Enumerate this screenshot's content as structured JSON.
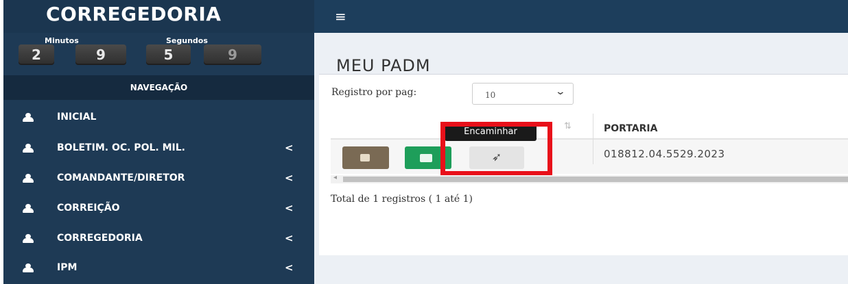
{
  "sidebar": {
    "brand": "CORREGEDORIA",
    "timer": {
      "minutes_label": "Minutos",
      "seconds_label": "Segundos",
      "digits": [
        "2",
        "9",
        "5",
        "9"
      ]
    },
    "nav_header": "NAVEGAÇÃO",
    "items": [
      {
        "label": "INICIAL",
        "icon": "user-icon",
        "chevron": ""
      },
      {
        "label": "BOLETIM. OC. POL. MIL.",
        "icon": "user-icon",
        "chevron": "<"
      },
      {
        "label": "COMANDANTE/DIRETOR",
        "icon": "user-icon",
        "chevron": "<"
      },
      {
        "label": "CORREIÇÃO",
        "icon": "user-icon",
        "chevron": "<"
      },
      {
        "label": "CORREGEDORIA",
        "icon": "user-icon",
        "chevron": "<"
      },
      {
        "label": "IPM",
        "icon": "user-icon",
        "chevron": "<"
      }
    ]
  },
  "header": {
    "menu_glyph": "≡"
  },
  "main": {
    "title": "MEU PADM",
    "per_page_label": "Registro por pag:",
    "per_page_value": "10",
    "sort_glyph": "⇅",
    "table": {
      "columns": [
        "PORTARIA"
      ],
      "rows": [
        {
          "portaria": "018812.04.5529.2023"
        }
      ]
    },
    "actions": {
      "send_tooltip": "Encaminhar",
      "send_glyph": "➶"
    },
    "footer_total": "Total de 1 registros ( 1 até 1)"
  },
  "colors": {
    "sidebar_bg": "#1e3a55",
    "highlight": "#e8101a",
    "edit_button": "#7a6a54",
    "folder_button": "#1e9e5a"
  }
}
